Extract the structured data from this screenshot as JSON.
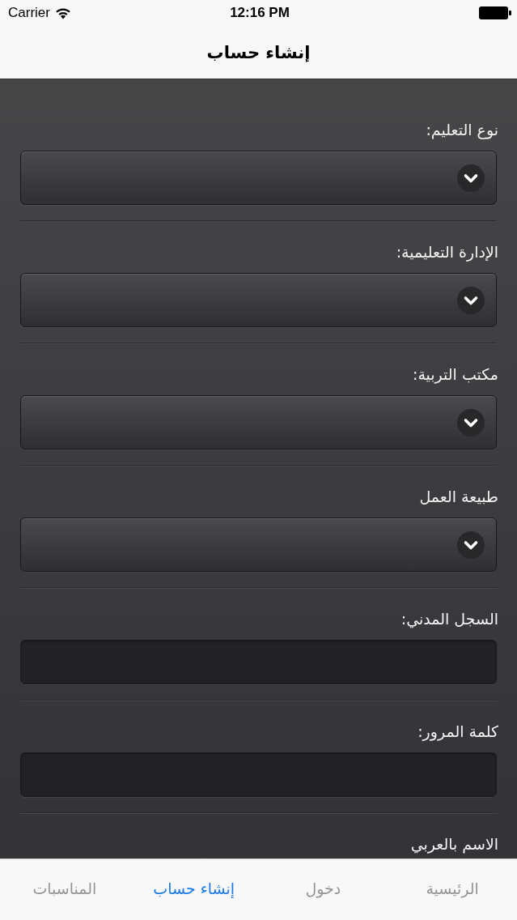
{
  "status_bar": {
    "carrier": "Carrier",
    "time": "12:16 PM"
  },
  "nav_bar": {
    "title": "إنشاء حساب"
  },
  "form": {
    "fields": [
      {
        "label": "نوع التعليم:",
        "kind": "dropdown"
      },
      {
        "label": "الإدارة التعليمية:",
        "kind": "dropdown"
      },
      {
        "label": "مكتب التربية:",
        "kind": "dropdown"
      },
      {
        "label": "طبيعة العمل",
        "kind": "dropdown"
      },
      {
        "label": "السجل المدني:",
        "kind": "text"
      },
      {
        "label": "كلمة المرور:",
        "kind": "text"
      },
      {
        "label": "الاسم بالعربي"
      }
    ]
  },
  "tab_bar": {
    "tabs": [
      {
        "label": "الرئيسية",
        "selected": false
      },
      {
        "label": "دخول",
        "selected": false
      },
      {
        "label": "إنشاء حساب",
        "selected": true
      },
      {
        "label": "المناسبات",
        "selected": false
      }
    ]
  }
}
